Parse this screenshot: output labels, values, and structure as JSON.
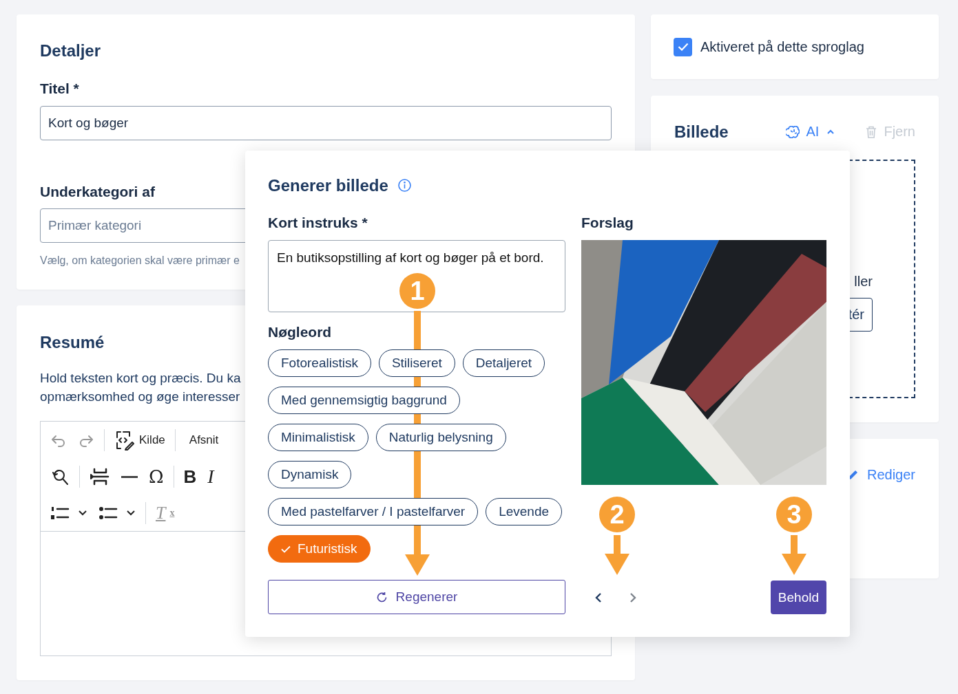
{
  "details": {
    "title": "Detaljer",
    "title_label": "Titel *",
    "title_value": "Kort og bøger",
    "parent_label": "Underkategori af",
    "parent_placeholder": "Primær kategori",
    "parent_help": "Vælg, om kategorien skal være primær e"
  },
  "summary": {
    "title": "Resumé",
    "lines": [
      "Hold teksten kort og præcis. Du ka",
      "opmærksomhed og øge interesser"
    ],
    "toolbar": [
      [
        {
          "kind": "undo",
          "disabled": true
        },
        {
          "kind": "redo",
          "disabled": true
        },
        {
          "kind": "separator"
        },
        {
          "kind": "source",
          "label": "Kilde"
        },
        {
          "kind": "separator"
        },
        {
          "kind": "heading",
          "label": "Afsnit"
        }
      ],
      [
        {
          "kind": "find"
        },
        {
          "kind": "separator"
        },
        {
          "kind": "page-break"
        },
        {
          "kind": "horizontal-line"
        },
        {
          "kind": "glyph",
          "glyph": "Ω"
        },
        {
          "kind": "separator"
        },
        {
          "kind": "bold",
          "glyph": "B"
        },
        {
          "kind": "italic",
          "glyph": "I"
        }
      ],
      [
        {
          "kind": "numbered-list"
        },
        {
          "kind": "bulleted-list"
        },
        {
          "kind": "separator"
        },
        {
          "kind": "clear-format",
          "glyph": "T",
          "sub": "x",
          "disabled": true
        }
      ]
    ]
  },
  "enabled_card": {
    "label": "Aktiveret på dette sproglag",
    "checked": true
  },
  "image_card": {
    "title": "Billede",
    "ai_label": "AI",
    "expanded": true,
    "remove_label": "Fjern",
    "remove_disabled": true,
    "drop_text": "ller",
    "drop_button": "tér"
  },
  "edit_card": {
    "edit_label": "Rediger"
  },
  "generate": {
    "title": "Generer billede",
    "prompt_label": "Kort instruks *",
    "prompt_value": "En butiksopstilling af kort og bøger på et bord.",
    "keywords_label": "Nøgleord",
    "keywords": [
      {
        "label": "Fotorealistisk",
        "selected": false
      },
      {
        "label": "Stiliseret",
        "selected": false
      },
      {
        "label": "Detaljeret",
        "selected": false
      },
      {
        "label": "Med gennemsigtig baggrund",
        "selected": false
      },
      {
        "label": "Minimalistisk",
        "selected": false
      },
      {
        "label": "Naturlig belysning",
        "selected": false
      },
      {
        "label": "Dynamisk",
        "selected": false
      },
      {
        "label": "Med pastelfarver / I pastelfarver",
        "selected": false
      },
      {
        "label": "Levende",
        "selected": false
      },
      {
        "label": "Futuristisk",
        "selected": true
      }
    ],
    "regenerate_label": "Regenerer",
    "suggestion_label": "Forslag",
    "nav_buttons": [
      {
        "kind": "prev",
        "disabled": false
      },
      {
        "kind": "next",
        "disabled": true
      }
    ],
    "keep_label": "Behold"
  },
  "annotations": [
    {
      "label": "1"
    },
    {
      "label": "2"
    },
    {
      "label": "3"
    }
  ]
}
